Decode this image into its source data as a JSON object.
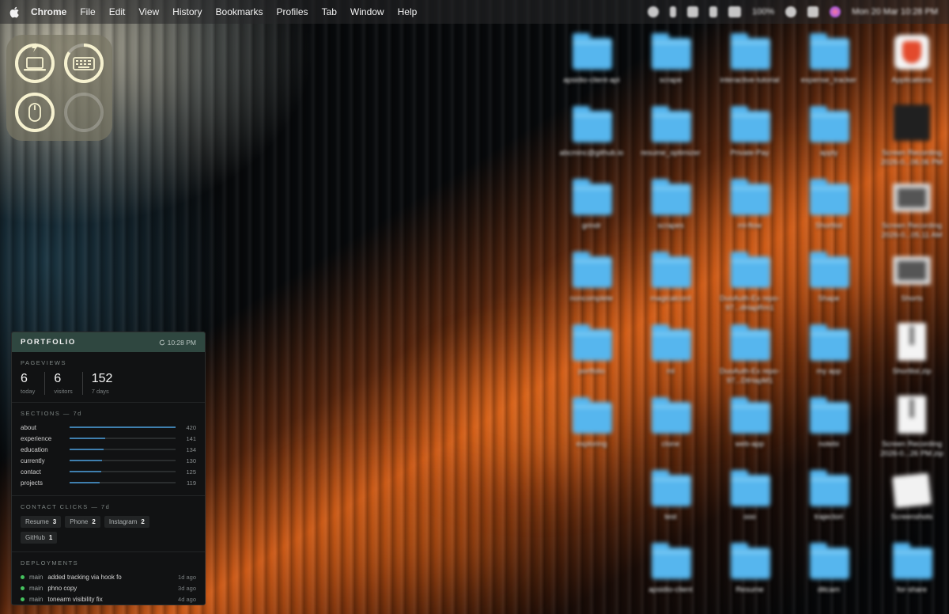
{
  "menubar": {
    "items": [
      "Chrome",
      "File",
      "Edit",
      "View",
      "History",
      "Bookmarks",
      "Profiles",
      "Tab",
      "Window",
      "Help"
    ],
    "status_battery": "100%",
    "status_clock": "Mon 20 Mar  10:28 PM"
  },
  "battery_widget": {
    "devices": [
      {
        "name": "laptop-icon",
        "level": 1.0,
        "charging": true
      },
      {
        "name": "keyboard-icon",
        "level": 0.85
      },
      {
        "name": "mouse-icon",
        "level": 1.0
      },
      {
        "name": "empty-slot",
        "level": 0
      }
    ],
    "colors": {
      "ring": "#f6f1cf",
      "track": "rgba(255,255,255,0.25)"
    }
  },
  "portfolio": {
    "title": "PORTFOLIO",
    "updated": "10:28 PM",
    "pageviews": {
      "title": "PAGEVIEWS",
      "stats": [
        {
          "value": "6",
          "label": "today"
        },
        {
          "value": "6",
          "label": "visitors"
        },
        {
          "value": "152",
          "label": "7 days"
        }
      ]
    },
    "sections": {
      "title": "SECTIONS — 7d",
      "rows": [
        {
          "label": "about",
          "value": 420
        },
        {
          "label": "experience",
          "value": 141
        },
        {
          "label": "education",
          "value": 134
        },
        {
          "label": "currently",
          "value": 130
        },
        {
          "label": "contact",
          "value": 125
        },
        {
          "label": "projects",
          "value": 119
        }
      ],
      "max": 420
    },
    "contact_clicks": {
      "title": "CONTACT CLICKS — 7d",
      "chips": [
        {
          "label": "Resume",
          "count": "3"
        },
        {
          "label": "Phone",
          "count": "2"
        },
        {
          "label": "Instagram",
          "count": "2"
        },
        {
          "label": "GitHub",
          "count": "1"
        }
      ]
    },
    "deployments": {
      "title": "DEPLOYMENTS",
      "rows": [
        {
          "branch": "main",
          "message": "added tracking via hook fo",
          "time": "1d ago"
        },
        {
          "branch": "main",
          "message": "phno copy",
          "time": "3d ago"
        },
        {
          "branch": "main",
          "message": "tonearm visibility fix",
          "time": "4d ago"
        }
      ],
      "status_color": "#45c25e"
    }
  },
  "desktop": {
    "icons": [
      {
        "kind": "folder",
        "label": "apsidio-client-api"
      },
      {
        "kind": "folder",
        "label": "scrape"
      },
      {
        "kind": "folder",
        "label": "interactive-tutorial"
      },
      {
        "kind": "folder",
        "label": "expense_tracker"
      },
      {
        "kind": "app",
        "label": "Applications"
      },
      {
        "kind": "folder",
        "label": "abcminc@github.io"
      },
      {
        "kind": "folder",
        "label": "resume_optimizer"
      },
      {
        "kind": "folder",
        "label": "Private-Pay"
      },
      {
        "kind": "folder",
        "label": "apply"
      },
      {
        "kind": "screenrec",
        "label": "Screen Recording 2026-0...06.06 PM"
      },
      {
        "kind": "folder",
        "label": "grindr"
      },
      {
        "kind": "folder",
        "label": "scrapes"
      },
      {
        "kind": "folder",
        "label": "ml-flow"
      },
      {
        "kind": "folder",
        "label": "Shortlist"
      },
      {
        "kind": "thumb",
        "label": "Screen Recording 2026-0...05.11 AM"
      },
      {
        "kind": "folder",
        "label": "noncomplete"
      },
      {
        "kind": "folder",
        "label": "magicalcord"
      },
      {
        "kind": "folder",
        "label": "DuoAuth-Ex repo-97...dHapRm1"
      },
      {
        "kind": "folder",
        "label": "Shape"
      },
      {
        "kind": "thumb",
        "label": "Shorts"
      },
      {
        "kind": "folder",
        "label": "portfolio"
      },
      {
        "kind": "folder",
        "label": "ml"
      },
      {
        "kind": "folder",
        "label": "DuoAuth-Ex repo-97...DtHapM1"
      },
      {
        "kind": "folder",
        "label": "my app"
      },
      {
        "kind": "zip",
        "label": "Shortlist.zip"
      },
      {
        "kind": "folder",
        "label": "exploring"
      },
      {
        "kind": "folder",
        "label": "clone"
      },
      {
        "kind": "folder",
        "label": "web-app"
      },
      {
        "kind": "folder",
        "label": "notebi"
      },
      {
        "kind": "zip",
        "label": "Screen Recording 2026-0...26 PM.zip"
      },
      {
        "kind": "folder",
        "label": "test"
      },
      {
        "kind": "folder",
        "label": "ooo"
      },
      {
        "kind": "folder",
        "label": "trajectori"
      },
      {
        "kind": "shots",
        "label": "Screenshots"
      },
      {
        "kind": "folder",
        "label": "apsidio-client"
      },
      {
        "kind": "folder",
        "label": "Resume"
      },
      {
        "kind": "folder",
        "label": "ditcam"
      },
      {
        "kind": "folder",
        "label": "for-share"
      }
    ],
    "colors": {
      "folder": "#56b6ee"
    }
  }
}
